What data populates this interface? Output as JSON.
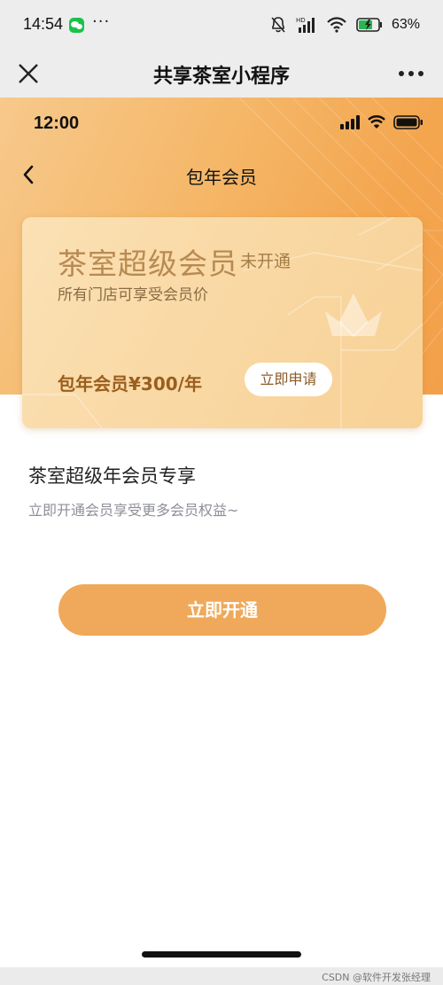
{
  "system_status": {
    "time": "14:54",
    "overflow_indicator": "···",
    "battery_percent": "63%",
    "icons": [
      "wechat-notification-icon",
      "mute-icon",
      "hd-signal-icon",
      "wifi-icon",
      "battery-charging-icon"
    ]
  },
  "miniprogram_bar": {
    "title": "共享茶室小程序",
    "close_icon": "close-icon",
    "more_icon": "more-icon"
  },
  "inner_status": {
    "time": "12:00",
    "icons": [
      "cellular-signal-icon",
      "wifi-icon",
      "battery-icon"
    ]
  },
  "page": {
    "title": "包年会员",
    "back_icon": "chevron-left-icon"
  },
  "card": {
    "title": "茶室超级会员",
    "status": "未开通",
    "subtitle": "所有门店可享受会员价",
    "price": "包年会员¥300/年",
    "apply_button": "立即申请",
    "emblem_icon": "crown-icon"
  },
  "benefits": {
    "title": "茶室超级年会员专享",
    "subtitle": "立即开通会员享受更多会员权益~"
  },
  "cta": {
    "label": "立即开通"
  },
  "watermark": "CSDN @软件开发张经理",
  "colors": {
    "hero_orange": "#f4a64f",
    "card_gold": "#f9d9a5",
    "cta_orange": "#f0a95a",
    "price_brown": "#9a5e1e"
  }
}
